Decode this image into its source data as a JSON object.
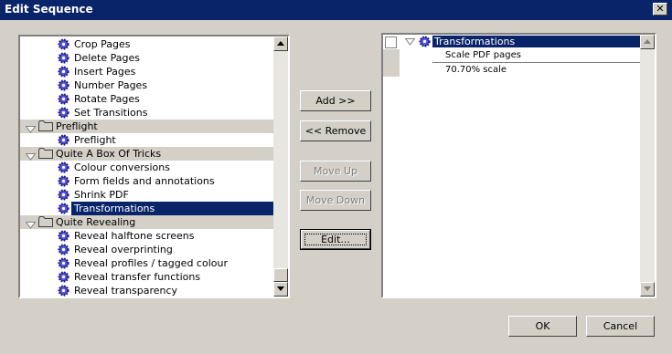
{
  "window": {
    "title": "Edit Sequence"
  },
  "left_list": {
    "rows": [
      {
        "kind": "item",
        "label": "Crop Pages"
      },
      {
        "kind": "item",
        "label": "Delete Pages"
      },
      {
        "kind": "item",
        "label": "Insert Pages"
      },
      {
        "kind": "item",
        "label": "Number Pages"
      },
      {
        "kind": "item",
        "label": "Rotate Pages"
      },
      {
        "kind": "item",
        "label": "Set Transitions"
      },
      {
        "kind": "group",
        "label": "Preflight"
      },
      {
        "kind": "item",
        "label": "Preflight"
      },
      {
        "kind": "group",
        "label": "Quite A Box Of Tricks"
      },
      {
        "kind": "item",
        "label": "Colour conversions"
      },
      {
        "kind": "item",
        "label": "Form fields and annotations"
      },
      {
        "kind": "item",
        "label": "Shrink PDF"
      },
      {
        "kind": "item",
        "label": "Transformations",
        "selected": true
      },
      {
        "kind": "group",
        "label": "Quite Revealing"
      },
      {
        "kind": "item",
        "label": "Reveal halftone screens"
      },
      {
        "kind": "item",
        "label": "Reveal overprinting"
      },
      {
        "kind": "item",
        "label": "Reveal profiles / tagged colour"
      },
      {
        "kind": "item",
        "label": "Reveal transfer functions"
      },
      {
        "kind": "item",
        "label": "Reveal transparency"
      }
    ]
  },
  "buttons": {
    "add": "Add >>",
    "remove": "<< Remove",
    "move_up": "Move Up",
    "move_down": "Move Down",
    "edit": "Edit...",
    "ok": "OK",
    "cancel": "Cancel"
  },
  "sequence": {
    "item": {
      "label": "Transformations",
      "checked": false
    },
    "details": [
      "Scale PDF pages",
      "70.70% scale"
    ]
  },
  "colors": {
    "title_bar": "#0a246a",
    "face": "#d4d0c8",
    "selection": "#0a246a"
  },
  "icons": {
    "action": "gear-icon",
    "group": "folder-icon",
    "expander": "triangle-down-icon"
  }
}
